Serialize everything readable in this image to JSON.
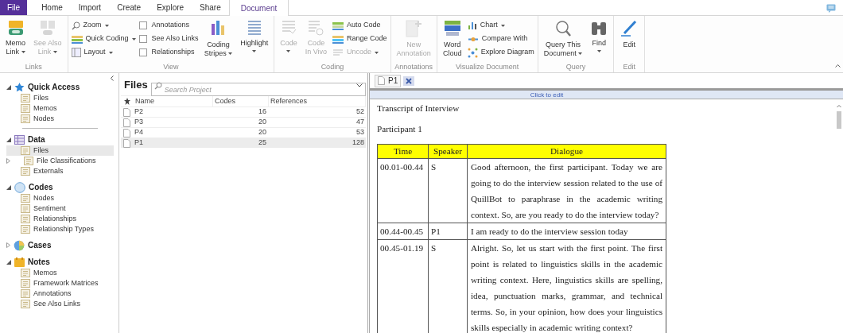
{
  "menu_tabs": [
    {
      "label": "File",
      "kind": "file",
      "selected": false
    },
    {
      "label": "Home",
      "kind": "tab",
      "selected": false
    },
    {
      "label": "Import",
      "kind": "tab",
      "selected": false
    },
    {
      "label": "Create",
      "kind": "tab",
      "selected": false
    },
    {
      "label": "Explore",
      "kind": "tab",
      "selected": false
    },
    {
      "label": "Share",
      "kind": "tab",
      "selected": false
    },
    {
      "label": "Document",
      "kind": "tab",
      "selected": true
    }
  ],
  "ribbon": [
    {
      "group": "Links",
      "items": [
        {
          "kind": "large",
          "lines": [
            "Memo",
            "Link"
          ],
          "dropdown": true,
          "disabled": false
        },
        {
          "kind": "large",
          "lines": [
            "See Also",
            "Link"
          ],
          "dropdown": true,
          "disabled": true
        }
      ]
    },
    {
      "group": "View",
      "items": [
        {
          "kind": "stack",
          "items": [
            {
              "kind": "small",
              "label": "Zoom",
              "dropdown": true,
              "disabled": false
            },
            {
              "kind": "small",
              "label": "Quick Coding",
              "dropdown": true,
              "disabled": false
            },
            {
              "kind": "small",
              "label": "Layout",
              "dropdown": true,
              "disabled": false
            }
          ]
        },
        {
          "kind": "stack",
          "items": [
            {
              "kind": "check",
              "label": "Annotations",
              "checked": false
            },
            {
              "kind": "check",
              "label": "See Also Links",
              "checked": false
            },
            {
              "kind": "check",
              "label": "Relationships",
              "checked": false
            }
          ]
        },
        {
          "kind": "large",
          "lines": [
            "Coding",
            "Stripes"
          ],
          "dropdown": true,
          "disabled": false
        },
        {
          "kind": "large",
          "lines": [
            "Highlight"
          ],
          "dropdown": true,
          "disabled": false
        }
      ]
    },
    {
      "group": "Coding",
      "items": [
        {
          "kind": "large",
          "lines": [
            "Code"
          ],
          "dropdown": true,
          "disabled": true
        },
        {
          "kind": "large",
          "lines": [
            "Code",
            "In Vivo"
          ],
          "dropdown": false,
          "disabled": true
        },
        {
          "kind": "stack",
          "items": [
            {
              "kind": "small",
              "label": "Auto Code",
              "dropdown": false,
              "disabled": false
            },
            {
              "kind": "small",
              "label": "Range Code",
              "dropdown": false,
              "disabled": false
            },
            {
              "kind": "small",
              "label": "Uncode",
              "dropdown": true,
              "disabled": true
            }
          ]
        }
      ]
    },
    {
      "group": "Annotations",
      "items": [
        {
          "kind": "large",
          "lines": [
            "New",
            "Annotation"
          ],
          "dropdown": false,
          "disabled": true
        }
      ]
    },
    {
      "group": "Visualize Document",
      "items": [
        {
          "kind": "large",
          "lines": [
            "Word",
            "Cloud"
          ],
          "dropdown": false,
          "disabled": false
        },
        {
          "kind": "stack",
          "items": [
            {
              "kind": "small",
              "label": "Chart",
              "dropdown": true,
              "disabled": false
            },
            {
              "kind": "small",
              "label": "Compare With",
              "dropdown": false,
              "disabled": false
            },
            {
              "kind": "small",
              "label": "Explore Diagram",
              "dropdown": false,
              "disabled": false
            }
          ]
        }
      ]
    },
    {
      "group": "Query",
      "items": [
        {
          "kind": "large",
          "lines": [
            "Query This",
            "Document"
          ],
          "dropdown": true,
          "disabled": false
        },
        {
          "kind": "large",
          "lines": [
            "Find"
          ],
          "dropdown": true,
          "disabled": false
        }
      ]
    },
    {
      "group": "Edit",
      "items": [
        {
          "kind": "large",
          "lines": [
            "Edit"
          ],
          "dropdown": false,
          "disabled": false
        }
      ]
    }
  ],
  "sidebar": [
    {
      "label": "Quick Access",
      "expanded": true,
      "children": [
        {
          "label": "Files",
          "selected": false
        },
        {
          "label": "Memos",
          "selected": false
        },
        {
          "label": "Nodes",
          "selected": false
        }
      ]
    },
    {
      "label": "Data",
      "expanded": true,
      "children": [
        {
          "label": "Files",
          "selected": true
        },
        {
          "label": "File Classifications",
          "selected": false,
          "expanded": false
        },
        {
          "label": "Externals",
          "selected": false
        }
      ]
    },
    {
      "label": "Codes",
      "expanded": true,
      "children": [
        {
          "label": "Nodes",
          "selected": false
        },
        {
          "label": "Sentiment",
          "selected": false
        },
        {
          "label": "Relationships",
          "selected": false
        },
        {
          "label": "Relationship Types",
          "selected": false
        }
      ]
    },
    {
      "label": "Cases",
      "expanded": false
    },
    {
      "label": "Notes",
      "expanded": true,
      "children": [
        {
          "label": "Memos",
          "selected": false
        },
        {
          "label": "Framework Matrices",
          "selected": false
        },
        {
          "label": "Annotations",
          "selected": false
        },
        {
          "label": "See Also Links",
          "selected": false
        }
      ]
    }
  ],
  "files_pane": {
    "title": "Files",
    "search": {
      "placeholder": "Search Project"
    },
    "columns": [
      "Name",
      "Codes",
      "References"
    ],
    "rows": [
      {
        "name": "P2",
        "codes": "16",
        "references": "52",
        "selected": false
      },
      {
        "name": "P3",
        "codes": "20",
        "references": "47",
        "selected": false
      },
      {
        "name": "P4",
        "codes": "20",
        "references": "53",
        "selected": false
      },
      {
        "name": "P1",
        "codes": "25",
        "references": "128",
        "selected": true
      }
    ]
  },
  "document": {
    "tab": {
      "label": "P1"
    },
    "edit_bar": "Click to edit",
    "title": "Transcript of Interview",
    "subtitle": "Participant 1",
    "table": {
      "columns": [
        "Time",
        "Speaker",
        "Dialogue"
      ],
      "rows": [
        {
          "time": "00.01-00.44",
          "speaker": "S",
          "dialogue": "Good afternoon, the first participant. Today we are going to do the interview session related to the use of QuillBot to paraphrase in the academic writing context. So, are you ready to do the interview today?"
        },
        {
          "time": "00.44-00.45",
          "speaker": "P1",
          "dialogue": "I am ready to do the interview session today"
        },
        {
          "time": "00.45-01.19",
          "speaker": "S",
          "dialogue": "Alright. So, let us start with the first point. The first point is related to linguistics skills in the academic writing context. Here, linguistics skills are spelling, idea, punctuation marks, grammar, and technical terms. So, in your opinion, how does your linguistics skills especially in academic writing context?"
        }
      ]
    }
  }
}
